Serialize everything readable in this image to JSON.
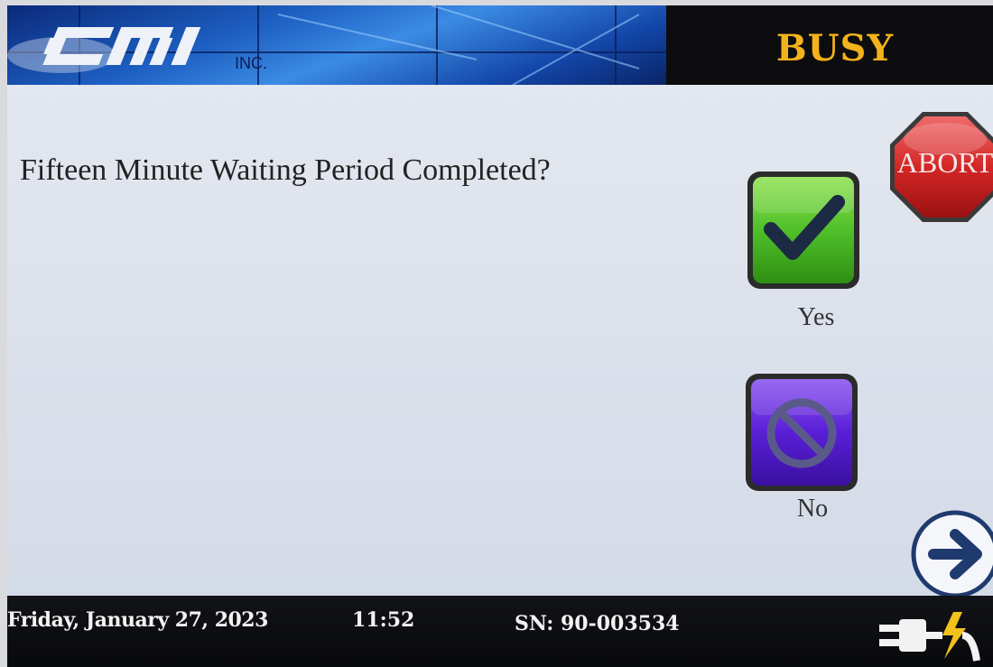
{
  "header": {
    "logo_text": "CMI",
    "logo_suffix": "INC.",
    "status": "BUSY"
  },
  "main": {
    "prompt": "Fifteen Minute Waiting Period Completed?",
    "abort_label": "ABORT",
    "yes_label": "Yes",
    "no_label": "No"
  },
  "footer": {
    "date": "Friday, January 27, 2023",
    "time": "11:52",
    "serial": "SN: 90-003534"
  },
  "icons": {
    "abort": "stop-sign-icon",
    "yes": "checkmark-icon",
    "no": "prohibited-icon",
    "next": "arrow-right-icon",
    "power": "power-plug-icon"
  },
  "colors": {
    "status": "#f2b21b",
    "yes_button": "#52c12a",
    "no_button": "#5a1fd6",
    "abort_button": "#d62a2a",
    "next_arrow": "#1f3a6e"
  }
}
